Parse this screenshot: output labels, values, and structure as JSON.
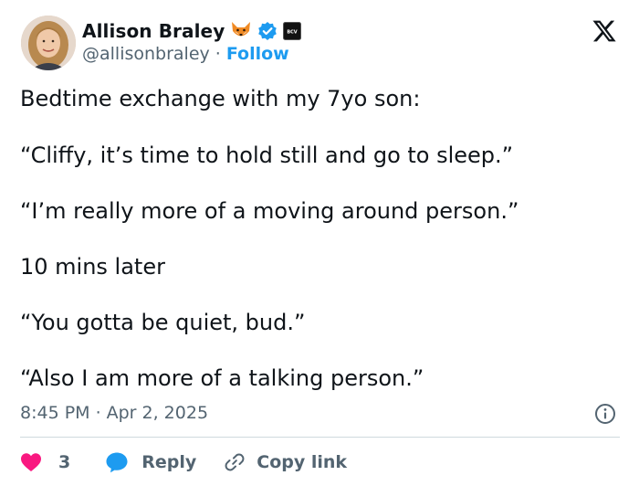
{
  "user": {
    "display_name": "Allison Braley",
    "handle": "@allisonbraley",
    "separator": "·",
    "follow_label": "Follow",
    "emoji_badge_icon": "fox-face-icon",
    "verified_icon": "verified-check-icon",
    "affiliate_badge_text": "BCV"
  },
  "platform": {
    "logo_icon": "x-logo-icon"
  },
  "tweet": {
    "lines": [
      "Bedtime exchange with my 7yo son:",
      "“Cliffy, it’s time to hold still and go to sleep.”",
      "“I’m really more of a moving around person.”",
      "10 mins later",
      "“You gotta be quiet, bud.”",
      "“Also I am more of a talking person.”"
    ],
    "time": "8:45 PM",
    "separator": "·",
    "date": "Apr 2, 2025"
  },
  "actions": {
    "like_count": "3",
    "reply_label": "Reply",
    "copy_link_label": "Copy link"
  },
  "colors": {
    "text": "#0f1419",
    "secondary": "#536471",
    "link": "#1d9bf0",
    "like": "#f91880",
    "divider": "#cfd9de"
  }
}
